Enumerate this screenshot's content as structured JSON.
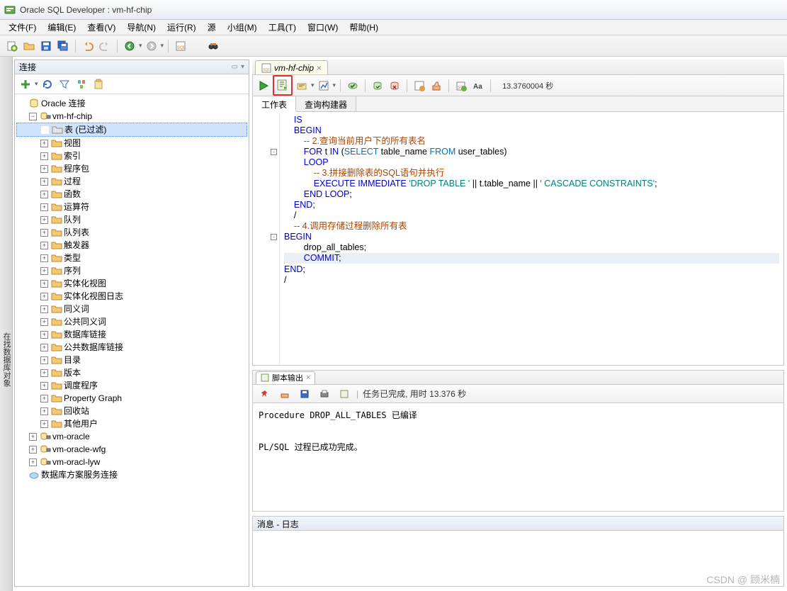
{
  "title": "Oracle SQL Developer : vm-hf-chip",
  "menu": [
    "文件(F)",
    "编辑(E)",
    "查看(V)",
    "导航(N)",
    "运行(R)",
    "源",
    "小组(M)",
    "工具(T)",
    "窗口(W)",
    "帮助(H)"
  ],
  "sidebarVerticalTab": "在找数据库对象",
  "connectionsPanel": {
    "title": "连接",
    "minimizeHint": "▭",
    "closeHint": "▾"
  },
  "tree": {
    "root": "Oracle 连接",
    "conn": "vm-hf-chip",
    "tablesFiltered": "表 (已过滤)",
    "children": [
      "视图",
      "索引",
      "程序包",
      "过程",
      "函数",
      "运算符",
      "队列",
      "队列表",
      "触发器",
      "类型",
      "序列",
      "实体化视图",
      "实体化视图日志",
      "同义词",
      "公共同义词",
      "数据库链接",
      "公共数据库链接",
      "目录",
      "版本",
      "调度程序",
      "Property Graph",
      "回收站",
      "其他用户"
    ],
    "otherConns": [
      "vm-oracle",
      "vm-oracle-wfg",
      "vm-oracl-lyw"
    ],
    "dbaas": "数据库方案服务连接"
  },
  "editor": {
    "tabName": "vm-hf-chip",
    "timeLabel": "13.3760004 秒",
    "subtabs": {
      "worksheet": "工作表",
      "queryBuilder": "查询构建器"
    }
  },
  "code": {
    "lines": [
      {
        "indent": 2,
        "cls": "kw",
        "text": "IS"
      },
      {
        "indent": 2,
        "cls": "kw",
        "text": "BEGIN"
      },
      {
        "indent": 4,
        "cls": "cm",
        "text": "-- 2.查询当前用户下的所有表名"
      },
      {
        "indent": 4,
        "fold": "-",
        "frag": [
          {
            "c": "kw",
            "t": "FOR"
          },
          {
            "c": "id",
            "t": " t "
          },
          {
            "c": "kw",
            "t": "IN"
          },
          {
            "c": "id",
            "t": " ("
          },
          {
            "c": "kw2",
            "t": "SELECT"
          },
          {
            "c": "id",
            "t": " table_name "
          },
          {
            "c": "kw2",
            "t": "FROM"
          },
          {
            "c": "id",
            "t": " user_tables)"
          }
        ]
      },
      {
        "indent": 4,
        "cls": "kw",
        "text": "LOOP"
      },
      {
        "indent": 6,
        "cls": "cm",
        "text": "-- 3.拼接删除表的SQL语句并执行"
      },
      {
        "indent": 6,
        "frag": [
          {
            "c": "kw",
            "t": "EXECUTE IMMEDIATE"
          },
          {
            "c": "id",
            "t": " "
          },
          {
            "c": "str",
            "t": "'DROP TABLE '"
          },
          {
            "c": "id",
            "t": " || t.table_name || "
          },
          {
            "c": "str",
            "t": "' CASCADE CONSTRAINTS'"
          },
          {
            "c": "id",
            "t": ";"
          }
        ]
      },
      {
        "indent": 4,
        "frag": [
          {
            "c": "kw",
            "t": "END LOOP"
          },
          {
            "c": "id",
            "t": ";"
          }
        ]
      },
      {
        "indent": 2,
        "frag": [
          {
            "c": "kw",
            "t": "END"
          },
          {
            "c": "id",
            "t": ";"
          }
        ]
      },
      {
        "indent": 2,
        "cls": "id",
        "text": "/"
      },
      {
        "indent": 2,
        "cls": "cm",
        "text": "-- 4.调用存储过程删除所有表"
      },
      {
        "indent": 0,
        "fold": "-",
        "cls": "kw",
        "text": "BEGIN"
      },
      {
        "indent": 4,
        "cls": "id",
        "text": "drop_all_tables;"
      },
      {
        "indent": 4,
        "hl": true,
        "frag": [
          {
            "c": "kw",
            "t": "COMMIT"
          },
          {
            "c": "id",
            "t": ";"
          }
        ]
      },
      {
        "indent": 0,
        "frag": [
          {
            "c": "kw",
            "t": "END"
          },
          {
            "c": "id",
            "t": ";"
          }
        ]
      },
      {
        "indent": 0,
        "cls": "id",
        "text": "/"
      }
    ]
  },
  "scriptOutput": {
    "tabTitle": "脚本输出",
    "status": "任务已完成, 用时 13.376 秒",
    "body": "Procedure DROP_ALL_TABLES 已编译\n\n\nPL/SQL 过程已成功完成。"
  },
  "log": {
    "title": "消息 - 日志"
  },
  "watermark": "CSDN @ 顾米楠"
}
